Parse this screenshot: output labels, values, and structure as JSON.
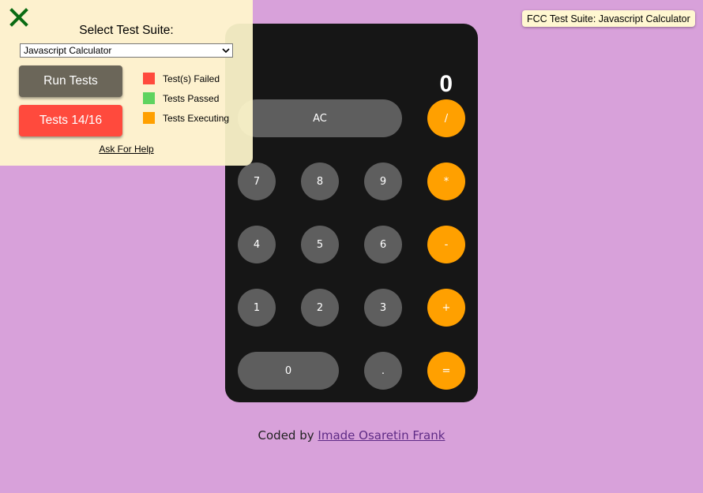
{
  "calculator": {
    "display": "0",
    "keys": {
      "ac": "AC",
      "divide": "/",
      "seven": "7",
      "eight": "8",
      "nine": "9",
      "multiply": "*",
      "four": "4",
      "five": "5",
      "six": "6",
      "subtract": "-",
      "one": "1",
      "two": "2",
      "three": "3",
      "add": "+",
      "zero": "0",
      "decimal": ".",
      "equals": "="
    },
    "colors": {
      "body": "#161616",
      "number_key": "#5e5e5e",
      "operator_key": "#ffa000"
    }
  },
  "footer": {
    "prefix": "Coded by",
    "author_link": "Imade Osaretin Frank"
  },
  "fcc_badge": {
    "label": "FCC Test Suite: Javascript Calculator"
  },
  "test_panel": {
    "title": "Select Test Suite:",
    "selected_suite": "Javascript Calculator",
    "run_button": "Run Tests",
    "tests_button": "Tests 14/16",
    "legend": [
      {
        "label": "Test(s) Failed",
        "color": "#ff4a3d"
      },
      {
        "label": "Tests Passed",
        "color": "#5fd35f"
      },
      {
        "label": "Tests Executing",
        "color": "#ffa000"
      }
    ],
    "help_link": "Ask For Help",
    "close_icon": "close-x-icon"
  },
  "page": {
    "background": "#d8a1da"
  }
}
